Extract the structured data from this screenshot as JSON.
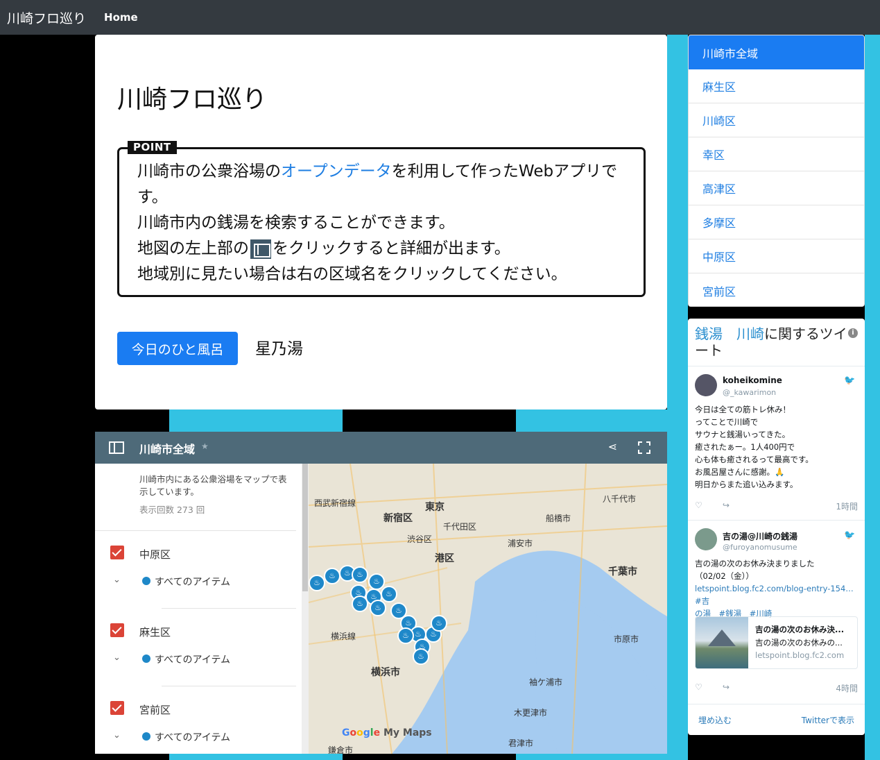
{
  "navbar": {
    "brand": "川崎フロ巡り",
    "home": "Home"
  },
  "hero": {
    "title": "川崎フロ巡り",
    "point_label": "POINT",
    "line1_a": "川崎市の公衆浴場の",
    "line1_link": "オープンデータ",
    "line1_b": "を利用して作ったWebアプリです。",
    "line2": "川崎市内の銭湯を検索することができます。",
    "line3_a": "地図の左上部の",
    "line3_b": "をクリックすると詳細が出ます。",
    "line4": "地域別に見たい場合は右の区域名をクリックしてください。",
    "today_button": "今日のひと風呂",
    "today_name": "星乃湯"
  },
  "wards": [
    "川崎市全域",
    "麻生区",
    "川崎区",
    "幸区",
    "高津区",
    "多摩区",
    "中原区",
    "宮前区"
  ],
  "twitter": {
    "heading_hl1": "銭湯",
    "heading_hl2": "川崎",
    "heading_rest": "に関するツイート",
    "info_icon": "i",
    "tweet1": {
      "name": "koheikomine",
      "handle": "@_kawarimon",
      "lines": [
        "今日は全ての筋トレ休み！",
        "ってことで川崎で",
        "サウナと銭湯いってきた。",
        "癒されたぁー。1人400円で",
        "心も体も癒されるって最高です。",
        "お風呂屋さんに感謝。🙏",
        "明日からまた追い込みます。"
      ],
      "time": "1時間"
    },
    "tweet2": {
      "name": "吉の湯@川崎の銭湯",
      "handle": "@furoyanomusume",
      "line1": "吉の湯の次のお休み決まりました",
      "line2": "（02/02（金））",
      "link": "letspoint.blog.fc2.com/blog-entry-154…",
      "tag_jp": "#吉",
      "tag_jp2": "の湯",
      "tag2": "#銭湯",
      "tag3": "#川崎",
      "card_title": "吉の湯の次のお休み決...",
      "card_desc": "吉の湯の次のお休みの...",
      "card_url": "letspoint.blog.fc2.com",
      "time": "4時間"
    },
    "embed": "埋め込む",
    "view": "Twitterで表示"
  },
  "map": {
    "title": "川崎市全域",
    "desc": "川崎市内にある公衆浴場をマップで表示しています。",
    "views": "表示回数 273 回",
    "layers": [
      "中原区",
      "麻生区",
      "宮前区"
    ],
    "all_items": "すべてのアイテム",
    "labels": {
      "tokyo": "東京",
      "shinjuku": "新宿区",
      "chiyoda": "千代田区",
      "minato": "港区",
      "shibuya": "渋谷区",
      "funabashi": "船橋市",
      "urayasu": "浦安市",
      "chiba": "千葉市",
      "yokohama": "横浜市",
      "ichihara": "市原市",
      "sodegaura": "袖ケ浦市",
      "kisarazu": "木更津市",
      "kimitsu": "君津市",
      "yachiyo": "八千代市",
      "seibu": "西武新宿線",
      "yokohama_line": "横浜線",
      "kamakura": "鎌倉市"
    },
    "google_my_maps": [
      "G",
      "o",
      "o",
      "g",
      "l",
      "e",
      " My Maps"
    ]
  },
  "colors": {
    "accent": "#1a7cf2",
    "link": "#1e7ee2",
    "mapbar": "#4e6a79",
    "check": "#db4437",
    "pin": "#1f88c9",
    "bg_cyan": "#33c2e3"
  }
}
